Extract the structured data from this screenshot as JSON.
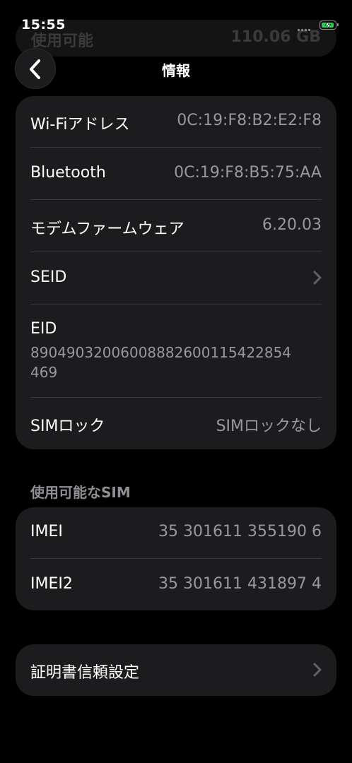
{
  "status": {
    "time": "15:55"
  },
  "background_ghost": {
    "left_text": "使用可能",
    "right_text": "110.06 GB"
  },
  "nav": {
    "title": "情報"
  },
  "rows": {
    "wifi": {
      "label": "Wi-Fiアドレス",
      "value": "0C:19:F8:B2:E2:F8"
    },
    "bluetooth": {
      "label": "Bluetooth",
      "value": "0C:19:F8:B5:75:AA"
    },
    "modem": {
      "label": "モデムファームウェア",
      "value": "6.20.03"
    },
    "seid": {
      "label": "SEID"
    },
    "eid": {
      "label": "EID",
      "value_line1": "89049032006008882600115422854",
      "value_line2": "469"
    },
    "simlock": {
      "label": "SIMロック",
      "value": "SIMロックなし"
    }
  },
  "sim_section": {
    "header": "使用可能なSIM",
    "imei": {
      "label": "IMEI",
      "value": "35 301611 355190 6"
    },
    "imei2": {
      "label": "IMEI2",
      "value": "35 301611 431897 4"
    }
  },
  "cert": {
    "label": "証明書信頼設定"
  },
  "icons": {
    "back": "chevron-left-icon",
    "disclosure": "chevron-right-icon",
    "battery": "battery-charging-icon",
    "signal": "signal-dots-icon"
  },
  "colors": {
    "battery_fill": "#34c759",
    "group_bg": "#1c1c1e",
    "secondary_text": "#98989f"
  }
}
